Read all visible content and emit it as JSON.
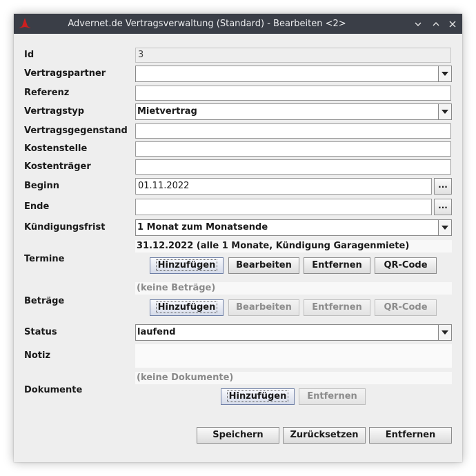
{
  "window": {
    "title": "Advernet.de Vertragsverwaltung (Standard) - Bearbeiten <2>",
    "controls": [
      "minimize-icon",
      "maximize-icon",
      "close-icon"
    ],
    "titlebar_color": "#3a3e47",
    "logo_color": "#cc1f1f"
  },
  "form": {
    "id": {
      "label": "Id",
      "value": "3"
    },
    "vertragspartner": {
      "label": "Vertragspartner",
      "value": ""
    },
    "referenz": {
      "label": "Referenz",
      "value": ""
    },
    "vertragstyp": {
      "label": "Vertragstyp",
      "value": "Mietvertrag"
    },
    "vertragsgegenstand": {
      "label": "Vertragsgegenstand",
      "value": ""
    },
    "kostenstelle": {
      "label": "Kostenstelle",
      "value": ""
    },
    "kostentraeger": {
      "label": "Kostenträger",
      "value": ""
    },
    "beginn": {
      "label": "Beginn",
      "value": "01.11.2022",
      "picker_label": "..."
    },
    "ende": {
      "label": "Ende",
      "value": "",
      "picker_label": "..."
    },
    "kuendigungsfrist": {
      "label": "Kündigungsfrist",
      "value": "1 Monat zum Monatsende"
    },
    "termine": {
      "label": "Termine",
      "entry": "31.12.2022 (alle 1 Monate, Kündigung Garagenmiete)",
      "buttons": {
        "add": "Hinzufügen",
        "edit": "Bearbeiten",
        "remove": "Entfernen",
        "qr": "QR-Code"
      }
    },
    "betraege": {
      "label": "Beträge",
      "entry": "(keine Beträge)",
      "buttons": {
        "add": "Hinzufügen",
        "edit": "Bearbeiten",
        "remove": "Entfernen",
        "qr": "QR-Code"
      }
    },
    "status": {
      "label": "Status",
      "value": "laufend"
    },
    "notiz": {
      "label": "Notiz",
      "value": ""
    },
    "dokumente": {
      "label": "Dokumente",
      "entry": "(keine Dokumente)",
      "buttons": {
        "add": "Hinzufügen",
        "remove": "Entfernen"
      }
    }
  },
  "footer": {
    "save": "Speichern",
    "reset": "Zurücksetzen",
    "cancel": "Entfernen"
  }
}
